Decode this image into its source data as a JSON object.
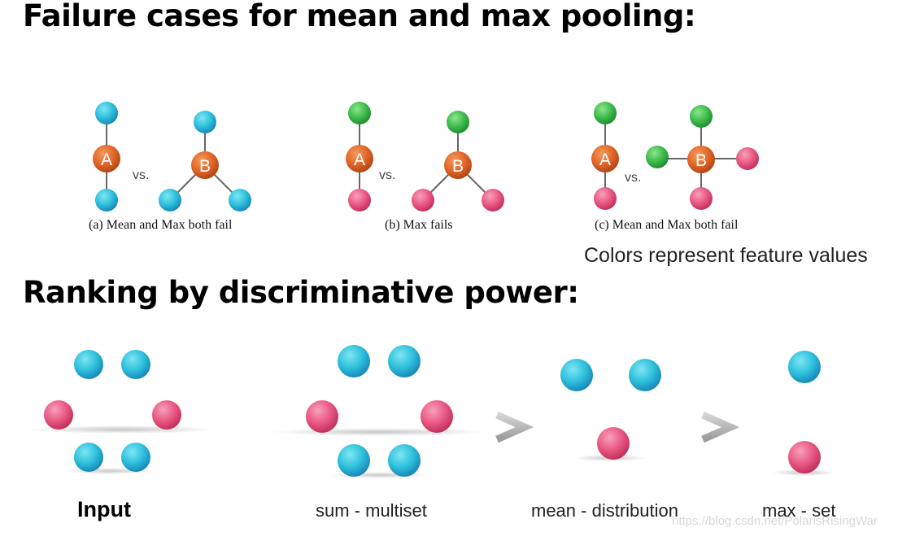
{
  "headings": {
    "failure": "Failure cases for mean and max pooling:",
    "ranking": "Ranking by discriminative power:"
  },
  "colors": {
    "blue": "#29b9d6",
    "green": "#3fb94d",
    "pink": "#e8557e",
    "orange": "#e0651f",
    "edge": "#666666",
    "gt": "#bdbdbd"
  },
  "panels": [
    {
      "caption": "(a) Mean and Max both fail",
      "left_label": "A",
      "right_label": "B",
      "vs": "vs."
    },
    {
      "caption": "(b) Max fails",
      "left_label": "A",
      "right_label": "B",
      "vs": "vs."
    },
    {
      "caption": "(c) Mean and Max both fail",
      "left_label": "A",
      "right_label": "B",
      "vs": "vs."
    }
  ],
  "note": "Colors represent feature values",
  "ranking": {
    "labels": [
      "Input",
      "sum - multiset",
      "mean - distribution",
      "max - set"
    ],
    "comparators": [
      ">",
      ">"
    ]
  },
  "watermark": "https://blog.csdn.net/PolarisRisingWar"
}
